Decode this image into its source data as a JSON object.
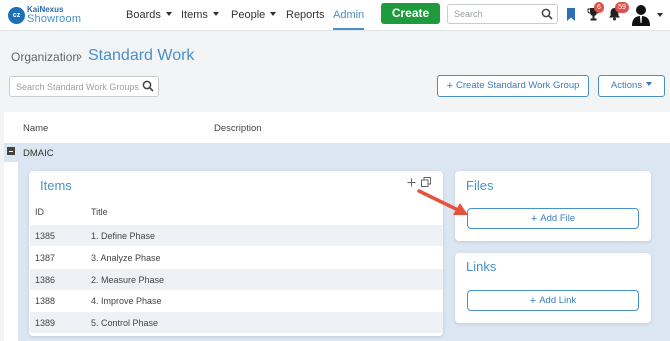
{
  "nav": {
    "logo_top": "KaiNexus",
    "logo_bottom": "Showroom",
    "logo_mark": "cz",
    "boards": "Boards",
    "items": "Items",
    "people": "People",
    "reports": "Reports",
    "admin": "Admin",
    "create": "Create",
    "search_placeholder": "Search",
    "trophy_badge": "6",
    "bell_badge": "59"
  },
  "breadcrumb": {
    "parent": "Organization",
    "separator": "›",
    "current": "Standard Work"
  },
  "toolbar": {
    "search_placeholder": "Search Standard Work Groups ...",
    "create_group": "Create Standard Work Group",
    "actions": "Actions"
  },
  "table": {
    "columns": [
      "Name",
      "Description"
    ],
    "group": {
      "name": "DMAIC",
      "items_panel": {
        "title": "Items",
        "columns": [
          "ID",
          "Title"
        ],
        "rows": [
          {
            "id": "1385",
            "title": "1. Define Phase"
          },
          {
            "id": "1387",
            "title": "3. Analyze Phase"
          },
          {
            "id": "1386",
            "title": "2. Measure Phase"
          },
          {
            "id": "1388",
            "title": "4. Improve Phase"
          },
          {
            "id": "1389",
            "title": "5. Control Phase"
          }
        ]
      },
      "files_panel": {
        "title": "Files",
        "add_label": "Add File"
      },
      "links_panel": {
        "title": "Links",
        "add_label": "Add Link"
      }
    }
  },
  "colors": {
    "accent": "#4a90c8",
    "create_green": "#1f9a3d",
    "badge_red": "#e0524a",
    "group_bg": "#dbe6f2",
    "annotation_arrow": "#e5533d"
  },
  "icons": [
    "search-icon",
    "bookmark-icon",
    "trophy-icon",
    "bell-icon",
    "avatar-icon",
    "plus-icon",
    "copy-icon",
    "collapse-icon",
    "arrow-annotation"
  ]
}
